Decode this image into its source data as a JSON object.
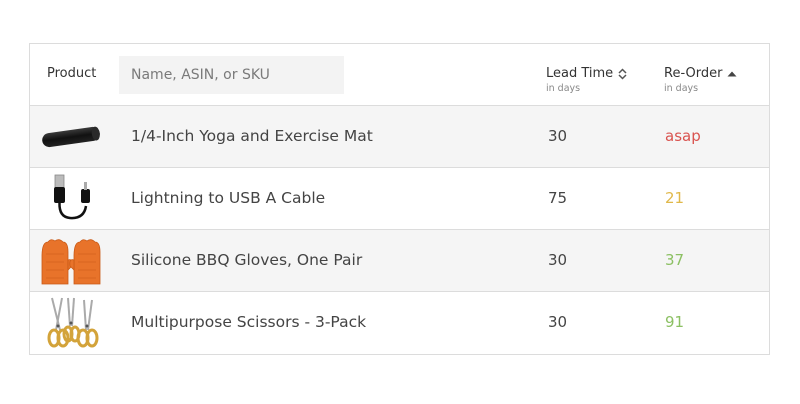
{
  "search": {
    "placeholder": "Name, ASIN, or SKU"
  },
  "columns": {
    "product": "Product",
    "lead_time": {
      "label": "Lead Time",
      "sub": "in days",
      "icon": "sort-both-icon"
    },
    "reorder": {
      "label": "Re-Order",
      "sub": "in days",
      "icon": "sort-ascending-icon"
    }
  },
  "rows": [
    {
      "name": "1/4-Inch Yoga and Exercise Mat",
      "lead_time": "30",
      "reorder": "asap",
      "reorder_color": "#d9534f",
      "thumb": "yoga-mat-icon"
    },
    {
      "name": "Lightning to USB A Cable",
      "lead_time": "75",
      "reorder": "21",
      "reorder_color": "#e0b84a",
      "thumb": "usb-cable-icon"
    },
    {
      "name": "Silicone BBQ Gloves, One Pair",
      "lead_time": "30",
      "reorder": "37",
      "reorder_color": "#8cc063",
      "thumb": "bbq-gloves-icon"
    },
    {
      "name": "Multipurpose Scissors - 3-Pack",
      "lead_time": "30",
      "reorder": "91",
      "reorder_color": "#8cc063",
      "thumb": "scissors-icon"
    }
  ]
}
